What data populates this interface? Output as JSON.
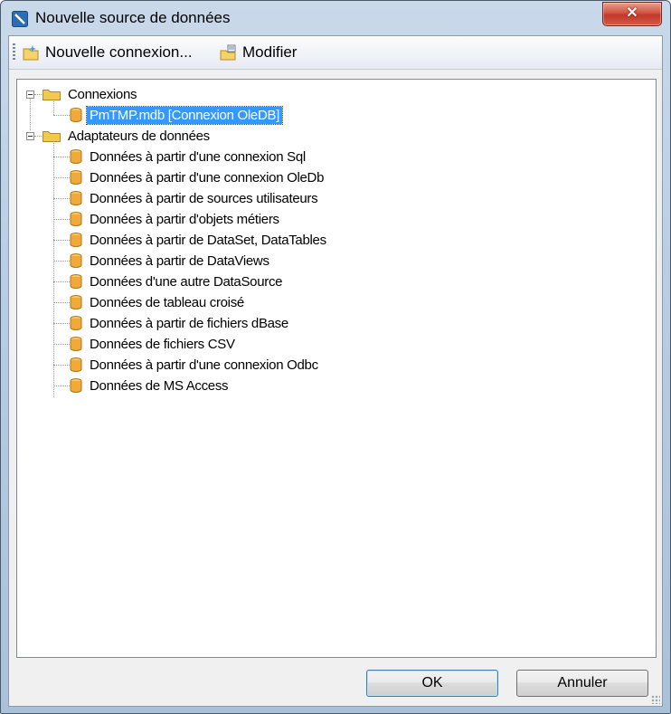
{
  "window": {
    "title": "Nouvelle source de données",
    "close_glyph": "✕"
  },
  "toolbar": {
    "new_connection_label": "Nouvelle connexion...",
    "modify_label": "Modifier"
  },
  "tree": {
    "connections_label": "Connexions",
    "connection_item": "PmTMP.mdb [Connexion OleDB]",
    "adapters_label": "Adaptateurs de données",
    "adapters": [
      "Données à partir d'une connexion Sql",
      "Données à partir d'une connexion OleDb",
      "Données à partir de sources utilisateurs",
      "Données à partir d'objets métiers",
      "Données à partir de DataSet, DataTables",
      "Données à partir de DataViews",
      "Données d'une autre DataSource",
      "Données de tableau croisé",
      "Données à partir de fichiers dBase",
      "Données de fichiers CSV",
      "Données à partir d'une connexion Odbc",
      "Données de MS Access"
    ]
  },
  "buttons": {
    "ok_label": "OK",
    "cancel_label": "Annuler"
  },
  "colors": {
    "selection": "#3399ff",
    "folder": "#f2c94c",
    "database": "#f0a93b"
  }
}
